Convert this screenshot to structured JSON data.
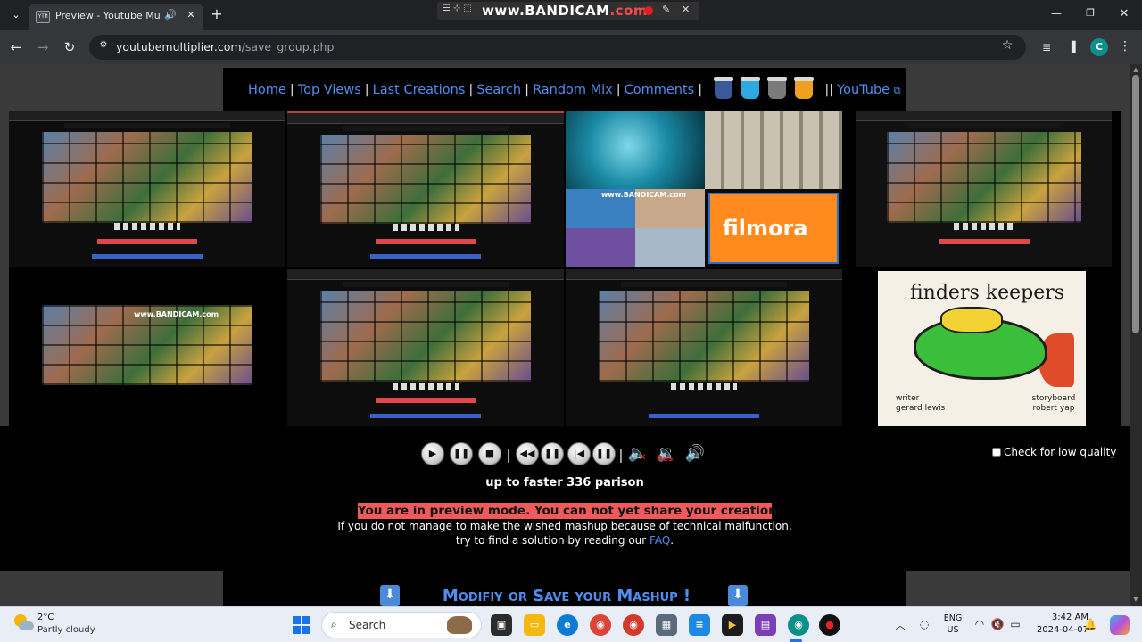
{
  "browser": {
    "tab_title": "Preview - Youtube Multiplier",
    "tab_favicon_text": "YTM",
    "url_domain": "youtubemultiplier.com",
    "url_path": "/save_group.php",
    "profile_initial": "C"
  },
  "bandicam": {
    "logo_main": "www.BANDICAM",
    "logo_suffix": ".com"
  },
  "nav": {
    "links": [
      "Home",
      "Top Views",
      "Last Creations",
      "Search",
      "Random Mix",
      "Comments"
    ],
    "youtube_label": "YouTube"
  },
  "thumbnails": {
    "filmora_label": "filmora",
    "bandicam_wm": "www.BANDICAM.com",
    "finders_title": "finders keepers",
    "writer_role": "writer",
    "writer_name": "gerard lewis",
    "storyboard_role": "storyboard",
    "storyboard_name": "robert yap"
  },
  "player": {
    "title": "up to faster 336 parison",
    "low_quality_label": "Check for low quality",
    "preview_message": "You are in preview mode. You can not yet share your creation",
    "help_line1": "If you do not manage to make the wished mashup because of technical malfunction,",
    "help_line2_prefix": "try to find a solution by reading our",
    "faq_label": "FAQ",
    "help_line2_suffix": ".",
    "modify_save_label": "Modifiy or Save your Mashup !"
  },
  "taskbar": {
    "temperature": "2°C",
    "condition": "Partly cloudy",
    "search_label": "Search",
    "lang_line1": "ENG",
    "lang_line2": "US",
    "time": "3:42 AM",
    "date": "2024-04-07"
  },
  "colors": {
    "link_blue": "#4f8ff0",
    "preview_red": "#f05a5a",
    "taskbar_bg": "#e9eef6"
  }
}
